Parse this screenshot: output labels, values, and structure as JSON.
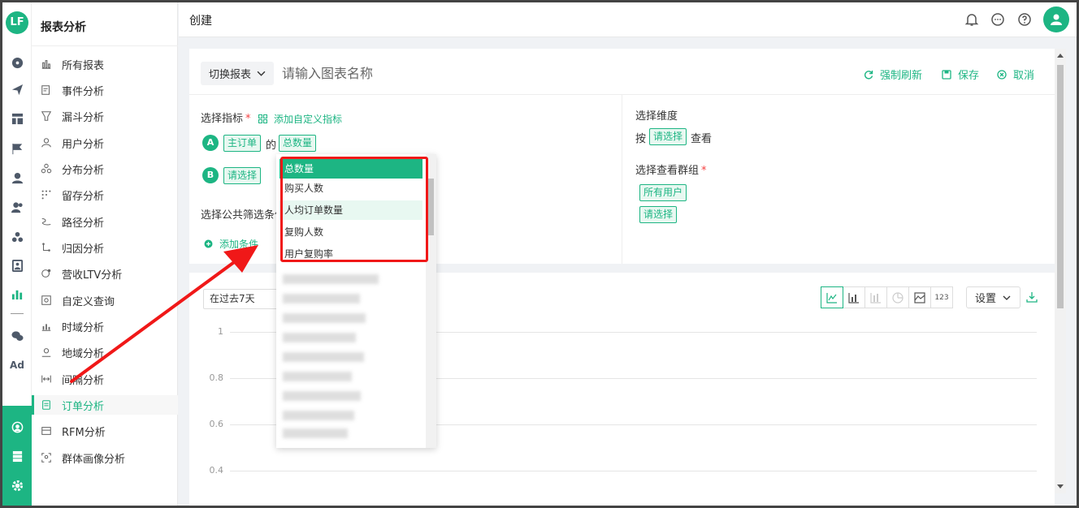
{
  "app": {
    "logo": "LF"
  },
  "rail": {
    "ad_label": "Ad"
  },
  "sidebar": {
    "title": "报表分析",
    "items": [
      {
        "label": "所有报表",
        "icon": "bar-chart-icon"
      },
      {
        "label": "事件分析",
        "icon": "event-icon"
      },
      {
        "label": "漏斗分析",
        "icon": "funnel-icon"
      },
      {
        "label": "用户分析",
        "icon": "user-icon"
      },
      {
        "label": "分布分析",
        "icon": "distribution-icon"
      },
      {
        "label": "留存分析",
        "icon": "retention-icon"
      },
      {
        "label": "路径分析",
        "icon": "path-icon"
      },
      {
        "label": "归因分析",
        "icon": "attribution-icon"
      },
      {
        "label": "营收LTV分析",
        "icon": "ltv-icon"
      },
      {
        "label": "自定义查询",
        "icon": "query-icon"
      },
      {
        "label": "时域分析",
        "icon": "time-chart-icon"
      },
      {
        "label": "地域分析",
        "icon": "location-icon"
      },
      {
        "label": "间隔分析",
        "icon": "interval-icon"
      },
      {
        "label": "订单分析",
        "icon": "order-icon",
        "active": true
      },
      {
        "label": "RFM分析",
        "icon": "rfm-icon"
      },
      {
        "label": "群体画像分析",
        "icon": "portrait-icon"
      }
    ]
  },
  "header": {
    "title": "创建"
  },
  "toolbar": {
    "switch_label": "切换报表",
    "name_placeholder": "请输入图表名称",
    "refresh_label": "强制刷新",
    "save_label": "保存",
    "cancel_label": "取消"
  },
  "metrics": {
    "label": "选择指标",
    "required_mark": "*",
    "add_custom_label": "添加自定义指标",
    "row_a": {
      "letter": "A",
      "subject": "主订单",
      "connector": "的",
      "metric": "总数量"
    },
    "row_b": {
      "letter": "B",
      "subject": "请选择"
    }
  },
  "filters": {
    "label": "选择公共筛选条件",
    "add_label": "添加条件"
  },
  "dimension": {
    "label": "选择维度",
    "prefix": "按",
    "value": "请选择",
    "suffix": "查看"
  },
  "group": {
    "label": "选择查看群组",
    "required_mark": "*",
    "all_users": "所有用户",
    "select": "请选择"
  },
  "dropdown": {
    "items": [
      "总数量",
      "购买人数",
      "人均订单数量",
      "复购人数",
      "用户复购率"
    ],
    "selected_index": 0,
    "hover_index": 2
  },
  "chart": {
    "date_range": "在过去7天",
    "type_number_label": "123",
    "settings_label": "设置",
    "y_ticks": [
      "1",
      "0.8",
      "0.6",
      "0.4"
    ]
  },
  "colors": {
    "accent": "#1db583",
    "highlight": "#f01818"
  }
}
